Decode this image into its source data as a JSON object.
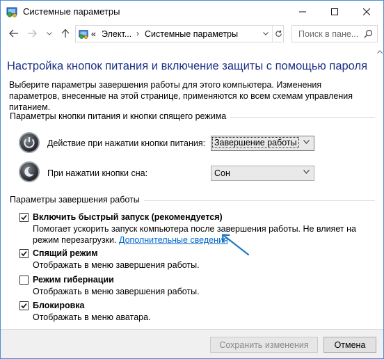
{
  "window": {
    "title": "Системные параметры",
    "minimize_glyph": "—",
    "maximize_glyph": "☐",
    "close_glyph": "✕"
  },
  "address": {
    "back_glyph": "←",
    "forward_glyph": "→",
    "recent_glyph": "⌄",
    "up_glyph": "↑",
    "chevrons": "«",
    "crumb1": "Элект...",
    "crumb_sep": "›",
    "crumb2": "Системные параметры"
  },
  "search": {
    "placeholder": "Поиск в пане..."
  },
  "main": {
    "heading": "Настройка кнопок питания и включение защиты с помощью пароля",
    "description": "Выберите параметры завершения работы для этого компьютера. Изменения параметров, внесенные на этой странице, применяются ко всем схемам управления питанием."
  },
  "power_section": {
    "label": "Параметры кнопки питания и кнопки спящего режима",
    "rows": [
      {
        "label": "Действие при нажатии кнопки питания:",
        "value": "Завершение работы"
      },
      {
        "label": "При нажатии кнопки сна:",
        "value": "Сон"
      }
    ]
  },
  "shutdown_section": {
    "label": "Параметры завершения работы",
    "items": [
      {
        "label": "Включить быстрый запуск (рекомендуется)",
        "checked": true,
        "desc1": "Помогает ускорить запуск компьютера после завершения работы. Не влияет на",
        "desc2_prefix": "режим перезагрузки. ",
        "desc2_link": "Дополнительные сведения"
      },
      {
        "label": "Спящий режим",
        "checked": true,
        "desc": "Отображать в меню завершения работы."
      },
      {
        "label": "Режим гибернации",
        "checked": false,
        "desc": "Отображать в меню завершения работы."
      },
      {
        "label": "Блокировка",
        "checked": true,
        "desc": "Отображать в меню аватара."
      }
    ]
  },
  "footer": {
    "save_label": "Сохранить изменения",
    "cancel_label": "Отмена"
  },
  "colors": {
    "heading": "#1e3287",
    "link": "#0066cc",
    "annotation_arrow": "#1a7ac4",
    "window_border": "#4a8fd8"
  },
  "icons": [
    "control-panel-icon",
    "back-arrow-icon",
    "forward-arrow-icon",
    "up-arrow-icon",
    "refresh-icon",
    "search-icon",
    "power-button-icon",
    "sleep-button-icon",
    "checkmark-icon",
    "chevron-down-icon"
  ]
}
